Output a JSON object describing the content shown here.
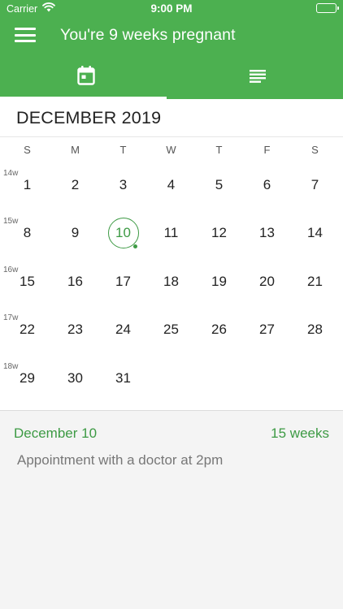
{
  "status": {
    "carrier": "Carrier",
    "time": "9:00 PM"
  },
  "header": {
    "title": "You're 9 weeks pregnant"
  },
  "tabs": [
    {
      "icon": "calendar-icon"
    },
    {
      "icon": "list-icon"
    }
  ],
  "calendar": {
    "month_label": "DECEMBER 2019",
    "weekdays": [
      "S",
      "M",
      "T",
      "W",
      "T",
      "F",
      "S"
    ],
    "weeks": [
      {
        "label": "14w",
        "days": [
          "1",
          "2",
          "3",
          "4",
          "5",
          "6",
          "7"
        ]
      },
      {
        "label": "15w",
        "days": [
          "8",
          "9",
          "10",
          "11",
          "12",
          "13",
          "14"
        ]
      },
      {
        "label": "16w",
        "days": [
          "15",
          "16",
          "17",
          "18",
          "19",
          "20",
          "21"
        ]
      },
      {
        "label": "17w",
        "days": [
          "22",
          "23",
          "24",
          "25",
          "26",
          "27",
          "28"
        ]
      },
      {
        "label": "18w",
        "days": [
          "29",
          "30",
          "31"
        ]
      }
    ],
    "selected_day": "10",
    "accent": "#3d9a44",
    "header_color": "#4cb050"
  },
  "detail": {
    "date": "December 10",
    "weeks": "15 weeks",
    "note": "Appointment with a doctor at 2pm"
  }
}
